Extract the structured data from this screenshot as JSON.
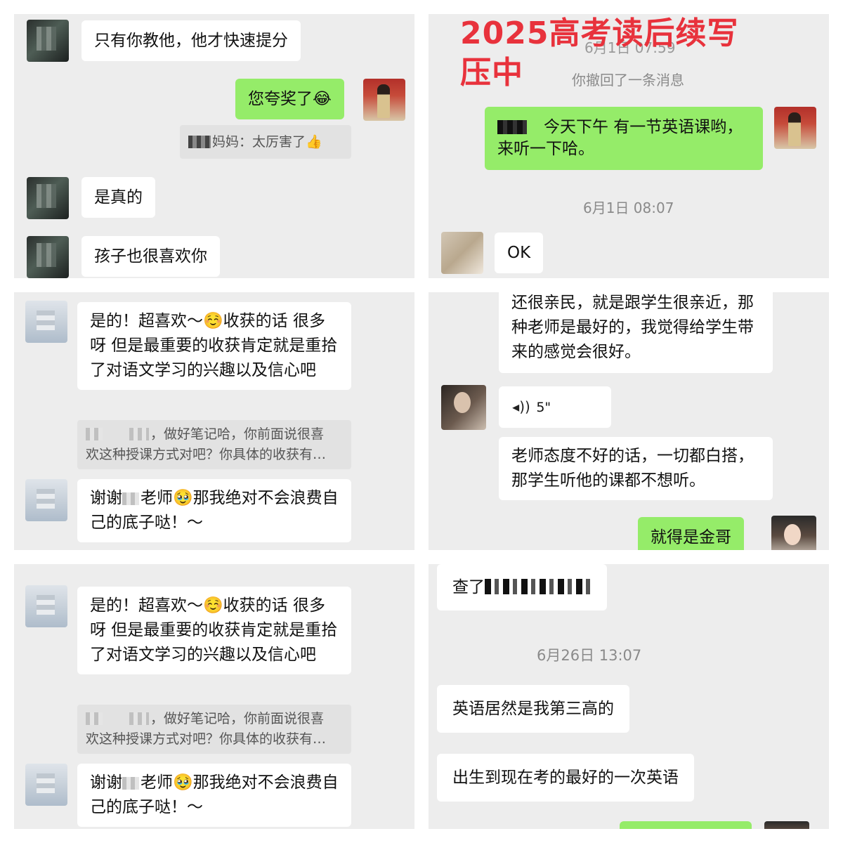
{
  "panel1": {
    "msg1": "只有你教他，他才快速提分",
    "msg2_text": "您夸奖了",
    "msg2_emoji": "😂",
    "quote_text": "妈妈：太厉害了",
    "quote_emoji": "👍",
    "msg3": "是真的",
    "msg4": "孩子也很喜欢你"
  },
  "panel2": {
    "title_line1": "2025高考读后续写",
    "title_line2": "压中",
    "faded_time": "6月1日 07:59",
    "recall_notice": "你撤回了一条消息",
    "msg1_line1": "今天下午 有一节英语课哟，",
    "msg1_line2": "来听一下哈。",
    "timestamp": "6月1日 08:07",
    "msg2": "OK"
  },
  "panel3": {
    "msg1_a": "是的！超喜欢～",
    "msg1_emoji": "☺️",
    "msg1_b": "收获的话 很多呀 但是最重要的收获肯定就是重拾了对语文学习的兴趣以及信心吧",
    "quote_line1": "，做好笔记哈，你前面说很喜",
    "quote_line2": "欢这种授课方式对吧？你具体的收获有…",
    "msg2_a": "谢谢",
    "msg2_b": "老师",
    "msg2_emoji": "🥹",
    "msg2_c": "那我绝对不会浪费自己的底子哒！～"
  },
  "panel4": {
    "msg1": "还很亲民，就是跟学生很亲近，那种老师是最好的，我觉得给学生带来的感觉会很好。",
    "voice_duration": "5\"",
    "msg2": "老师态度不好的话，一切都白搭，那学生听他的课都不想听。",
    "msg3": "就得是金哥"
  },
  "panel5": {
    "msg1_a": "是的！超喜欢～",
    "msg1_emoji": "☺️",
    "msg1_b": "收获的话 很多呀 但是最重要的收获肯定就是重拾了对语文学习的兴趣以及信心吧",
    "quote_line1": "，做好笔记哈，你前面说很喜",
    "quote_line2": "欢这种授课方式对吧？你具体的收获有…",
    "msg2_a": "谢谢",
    "msg2_b": "老师",
    "msg2_emoji": "🥹",
    "msg2_c": "那我绝对不会浪费自己的底子哒！～"
  },
  "panel6": {
    "msg1_prefix": "查了",
    "timestamp": "6月26日 13:07",
    "msg2": "英语居然是我第三高的",
    "msg3": "出生到现在考的最好的一次英语"
  },
  "colors": {
    "chat_background": "#ededed",
    "bubble_self": "#95ec69",
    "bubble_other": "#ffffff",
    "title_red": "#e8323c"
  }
}
